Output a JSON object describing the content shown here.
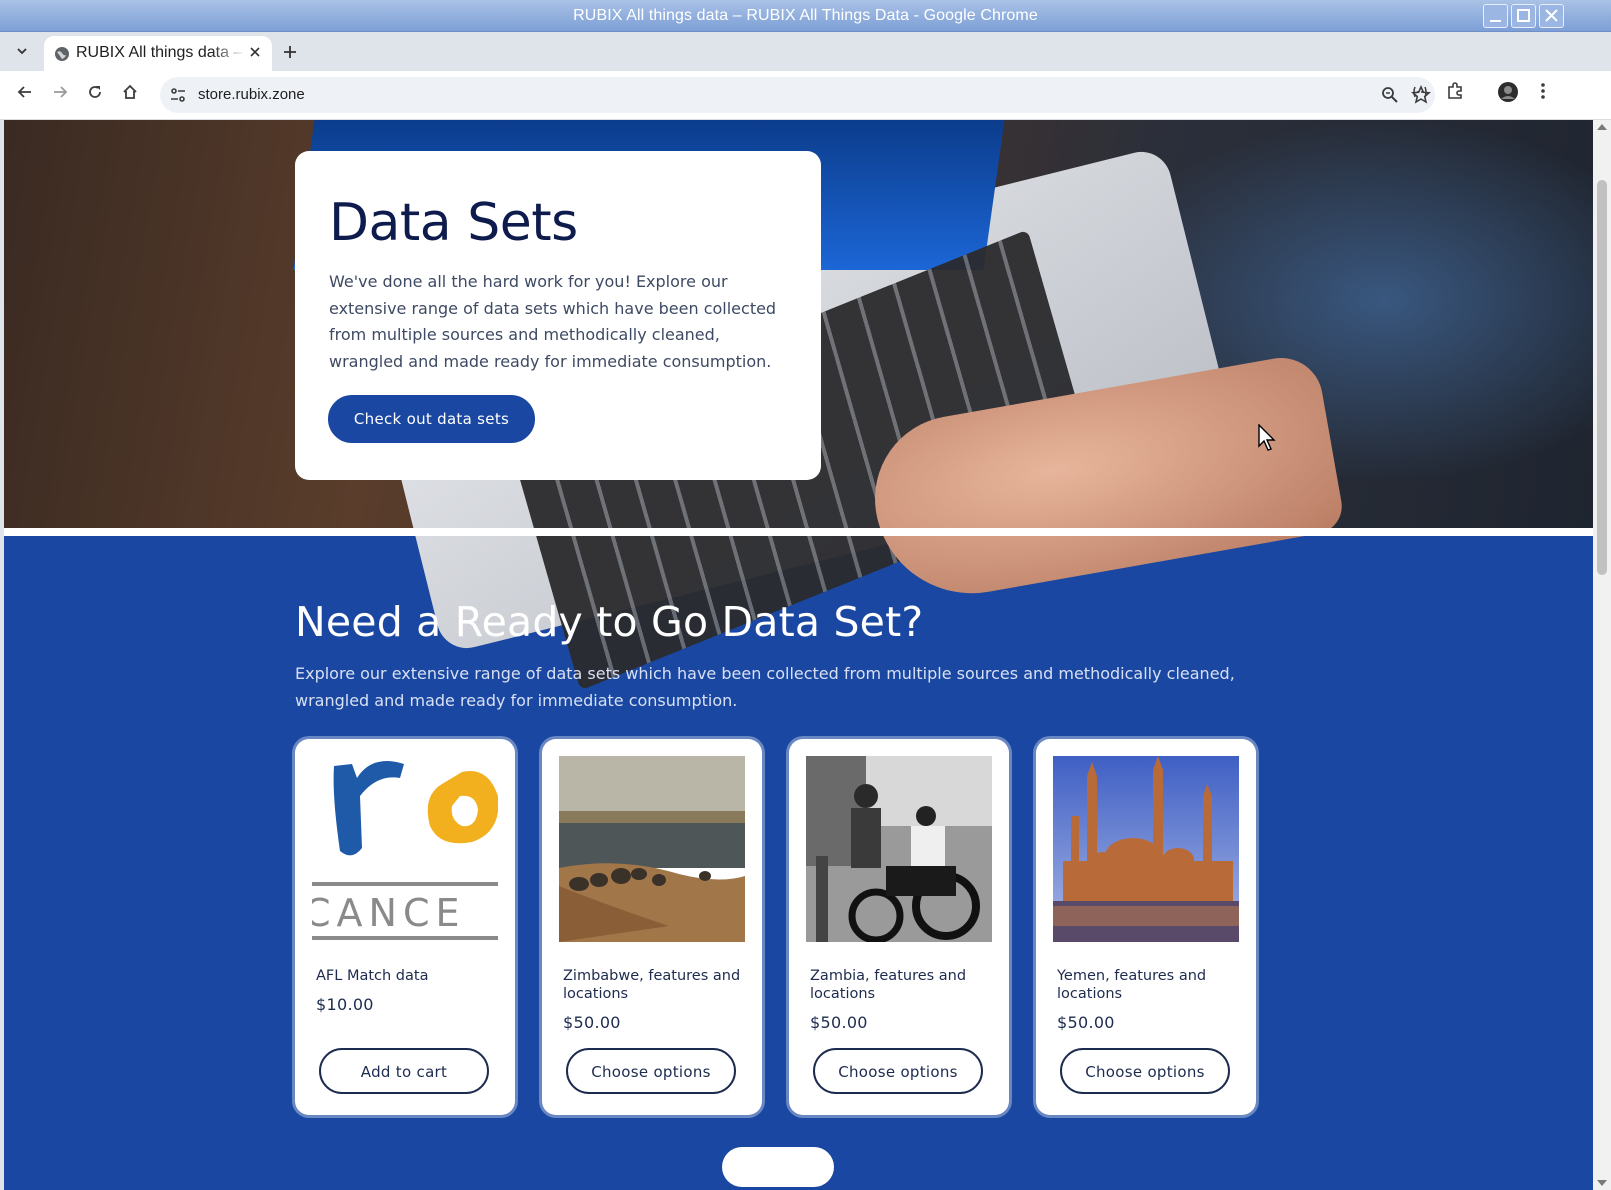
{
  "window": {
    "title": "RUBIX All things data – RUBIX All Things Data - Google Chrome",
    "buttons": {
      "minimize": "_",
      "maximize": "□",
      "close": "✕"
    }
  },
  "tabs": [
    {
      "title": "RUBIX All things data – RUBIX All Things Data",
      "close": "✕"
    }
  ],
  "tabstrip": {
    "dropdown": "⌄",
    "new_tab": "+"
  },
  "toolbar": {
    "url": "store.rubix.zone",
    "icons": [
      "back-icon",
      "forward-icon",
      "reload-icon",
      "home-icon",
      "site-settings-icon",
      "zoom-icon",
      "bookmark-star-icon",
      "reading-mode-icon",
      "extensions-icon",
      "profile-avatar",
      "menu-kebab-icon"
    ]
  },
  "hero": {
    "title": "Data Sets",
    "description": "We've done all the hard work for you! Explore our extensive range of data sets which have been collected from multiple sources and methodically cleaned, wrangled and made ready for immediate consumption.",
    "cta_label": "Check out data sets"
  },
  "products_section": {
    "title": "Need a Ready to Go Data Set?",
    "description": "Explore our extensive range of data sets which have been collected from multiple sources and methodically cleaned, wrangled and made ready for immediate consumption."
  },
  "products": [
    {
      "name": "AFL Match data",
      "price": "$10.00",
      "button": "Add to cart",
      "image": "logo-cancer-image"
    },
    {
      "name": "Zimbabwe, features and locations",
      "price": "$50.00",
      "button": "Choose options",
      "image": "elephants-waterhole-image"
    },
    {
      "name": "Zambia, features and locations",
      "price": "$50.00",
      "button": "Choose options",
      "image": "street-motorbikes-image"
    },
    {
      "name": "Yemen, features and locations",
      "price": "$50.00",
      "button": "Choose options",
      "image": "mosque-image"
    }
  ],
  "afl_logo_text": "CANCE",
  "colors": {
    "brand_blue": "#1a47a1",
    "navy_text": "#0d1b4d",
    "hero_card_bg": "#ffffff"
  }
}
